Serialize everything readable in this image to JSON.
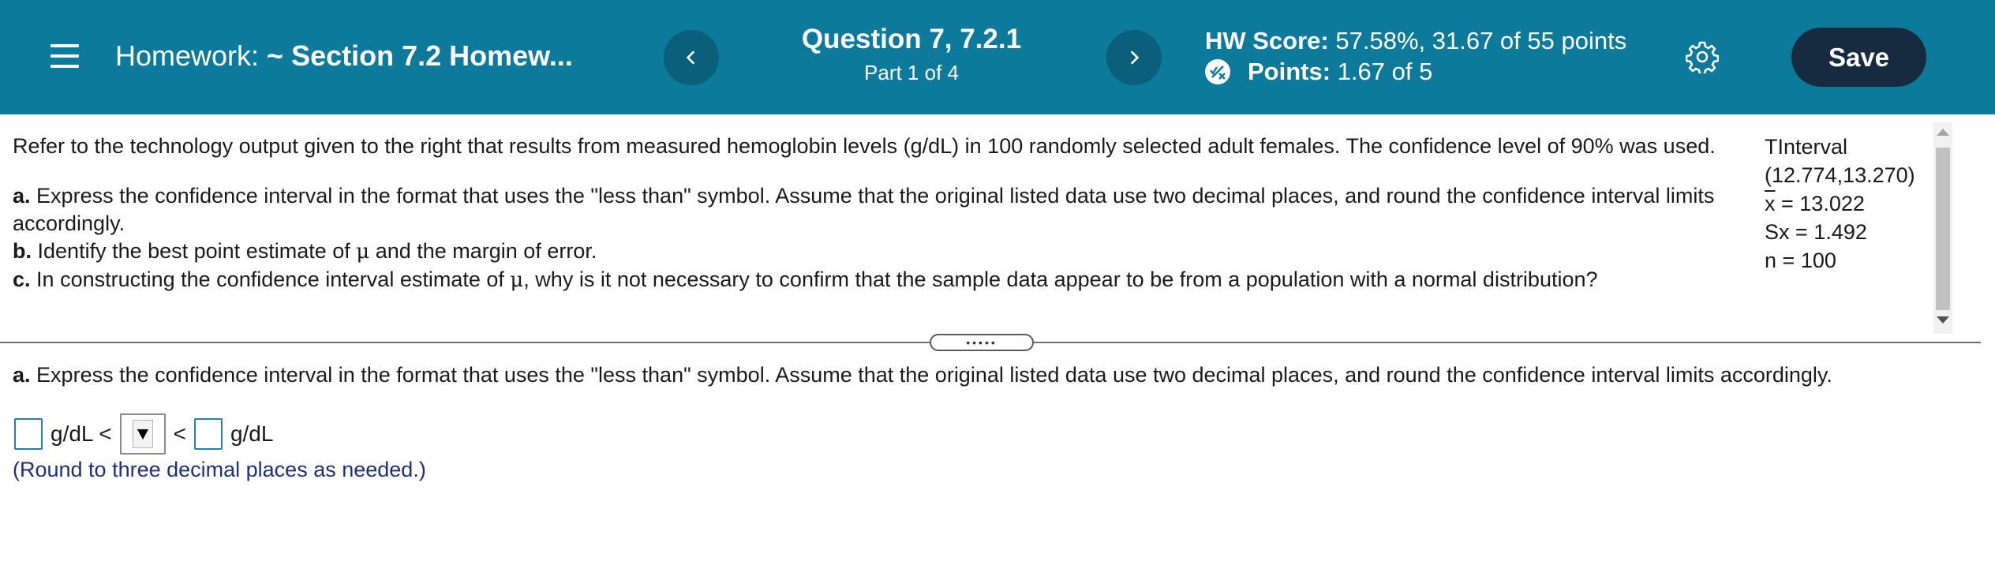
{
  "header": {
    "title_prefix": "Homework:",
    "title_section": "~ Section 7.2 Homew...",
    "question_title": "Question 7, 7.2.1",
    "question_part": "Part 1 of 4",
    "hw_score_label": "HW Score:",
    "hw_score_value": "57.58%, 31.67 of 55 points",
    "points_label": "Points:",
    "points_value": "1.67 of 5",
    "save_label": "Save",
    "icons": [
      "menu-icon",
      "chevron-left-icon",
      "chevron-right-icon",
      "partial-credit-icon",
      "gear-icon"
    ],
    "colors": {
      "header_bg": "#0d7a9b",
      "nav_button_bg": "#0a5f7a",
      "save_bg": "#172b40"
    }
  },
  "question": {
    "intro": "Refer to the technology output given to the right that results from measured hemoglobin levels (g/dL) in 100 randomly selected adult females. The confidence level of 90% was used.",
    "part_a_label": "a.",
    "part_a_text": "Express the confidence interval in the format that uses the \"less than\" symbol. Assume that the original listed data use two decimal places, and round the confidence interval limits accordingly.",
    "part_b_label": "b.",
    "part_b_text": "Identify the best point estimate of",
    "part_b_tail": "and the margin of error.",
    "part_c_label": "c.",
    "part_c_text": "In constructing the confidence interval estimate of",
    "part_c_tail": ", why is it not necessary to confirm that the sample data appear to be from a population with a normal distribution?",
    "mu_symbol": "μ"
  },
  "output": {
    "title": "TInterval",
    "interval": "(12.774,13.270)",
    "xbar_symbol": "x",
    "xbar_value": "= 13.022",
    "sx_label": "Sx",
    "sx_value": "= 1.492",
    "n_label": "n",
    "n_value": "= 100"
  },
  "divider": {
    "handle_dots": "•••••"
  },
  "answer": {
    "part_a_label": "a.",
    "part_a_text": "Express the confidence interval in the format that uses the \"less than\" symbol. Assume that the original listed data use two decimal places, and round the confidence interval limits accordingly.",
    "lower_value": "",
    "upper_value": "",
    "unit_left": "g/dL <",
    "less_than": "<",
    "unit_right": "g/dL",
    "round_note": "(Round to three decimal places as needed.)"
  }
}
